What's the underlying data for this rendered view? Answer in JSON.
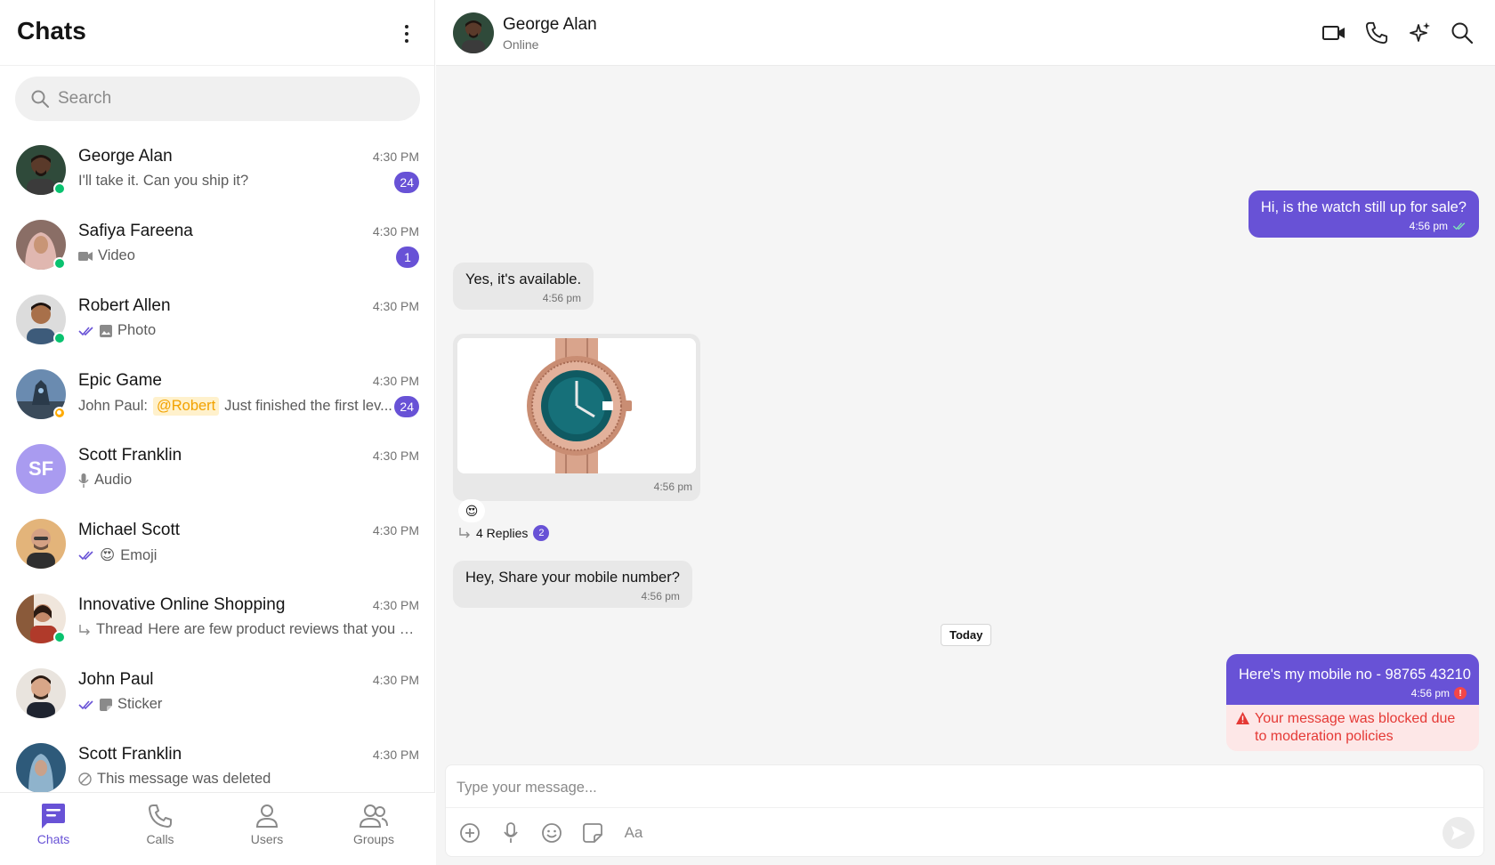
{
  "sidebar": {
    "title": "Chats",
    "search_placeholder": "Search",
    "chats": [
      {
        "name": "George Alan",
        "time": "4:30 PM",
        "preview": "I'll take it. Can you ship it?",
        "badge": "24",
        "avatar_color": "#3a2a22"
      },
      {
        "name": "Safiya Fareena",
        "time": "4:30 PM",
        "preview": "Video",
        "badge": "1",
        "avatar_color": "#c9a7a0"
      },
      {
        "name": "Robert Allen",
        "time": "4:30 PM",
        "preview": "Photo",
        "avatar_color": "#5c6a7a"
      },
      {
        "name": "Epic Game",
        "time": "4:30 PM",
        "preview_prefix": "John Paul:",
        "mention": "@Robert",
        "preview": "Just finished the first lev...",
        "badge": "24",
        "avatar_color": "#6a8bb0"
      },
      {
        "name": "Scott Franklin",
        "time": "4:30 PM",
        "initials": "SF",
        "preview": "Audio"
      },
      {
        "name": "Michael Scott",
        "time": "4:30 PM",
        "preview": "Emoji",
        "avatar_color": "#c9a27a"
      },
      {
        "name": "Innovative Online Shopping",
        "time": "4:30 PM",
        "preview_prefix": "Thread",
        "preview": "Here are few product reviews that you m...",
        "avatar_color": "#7a4a3a"
      },
      {
        "name": "John Paul",
        "time": "4:30 PM",
        "preview": "Sticker",
        "avatar_color": "#d9c7b8"
      },
      {
        "name": "Scott Franklin",
        "time": "4:30 PM",
        "preview": "This message was deleted",
        "avatar_color": "#3b6a8c"
      }
    ]
  },
  "nav": {
    "chats": "Chats",
    "calls": "Calls",
    "users": "Users",
    "groups": "Groups"
  },
  "conversation": {
    "name": "George Alan",
    "status": "Online",
    "messages": {
      "m1": {
        "text": "Hi, is the watch still up for sale?",
        "time": "4:56 pm"
      },
      "m2": {
        "text": "Yes, it's available.",
        "time": "4:56 pm"
      },
      "m3": {
        "time": "4:56 pm",
        "reaction": "😍",
        "replies_label": "4 Replies",
        "replies_count": "2"
      },
      "m4": {
        "text": "Hey, Share your mobile number?",
        "time": "4:56 pm"
      },
      "m5": {
        "text": "Here's my mobile no - 98765 43210",
        "time": "4:56 pm",
        "blocked_note": "Your message was blocked due to moderation policies"
      }
    },
    "date_separator": "Today",
    "composer_placeholder": "Type your message...",
    "text_format_label": "Aa"
  },
  "colors": {
    "accent": "#6852d6",
    "online": "#09c26f",
    "error": "#e53935"
  }
}
